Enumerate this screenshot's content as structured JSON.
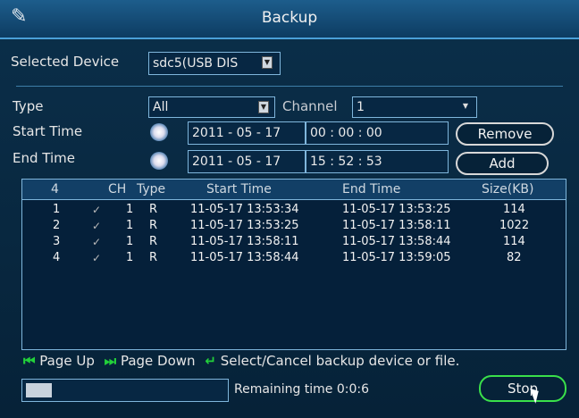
{
  "window": {
    "title": "Backup",
    "logo_icon": "wrench-logo-icon"
  },
  "selected_device": {
    "label": "Selected Device",
    "value": "sdc5(USB DIS"
  },
  "type": {
    "label": "Type",
    "value": "All"
  },
  "channel": {
    "label": "Channel",
    "value": "1"
  },
  "start_time": {
    "label": "Start Time",
    "date": "2011 - 05 - 17",
    "time": "00 : 00 : 00"
  },
  "end_time": {
    "label": "End Time",
    "date": "2011 - 05 - 17",
    "time": "15 : 52 : 53"
  },
  "buttons": {
    "remove": "Remove",
    "add": "Add",
    "stop": "Stop"
  },
  "table": {
    "headers": [
      "4",
      "CH",
      "Type",
      "Start Time",
      "End Time",
      "Size(KB)"
    ],
    "rows": [
      {
        "num": "1",
        "check": "✓",
        "ch": "1",
        "type": "R",
        "start": "11-05-17 13:53:34",
        "end": "11-05-17 13:53:25",
        "size": "114"
      },
      {
        "num": "2",
        "check": "✓",
        "ch": "1",
        "type": "R",
        "start": "11-05-17 13:53:25",
        "end": "11-05-17 13:58:11",
        "size": "1022"
      },
      {
        "num": "3",
        "check": "✓",
        "ch": "1",
        "type": "R",
        "start": "11-05-17 13:58:11",
        "end": "11-05-17 13:58:44",
        "size": "114"
      },
      {
        "num": "4",
        "check": "✓",
        "ch": "1",
        "type": "R",
        "start": "11-05-17 13:58:44",
        "end": "11-05-17 13:59:05",
        "size": "82"
      }
    ]
  },
  "footer": {
    "page_up": "Page Up",
    "page_down": "Page Down",
    "select_hint": "Select/Cancel backup device or file."
  },
  "progress": {
    "remaining_label": "Remaining time 0:0:6",
    "fraction": 0.13
  },
  "colors": {
    "accent": "#4aa0d8",
    "ok": "#3ae04a",
    "background": "#062238"
  }
}
